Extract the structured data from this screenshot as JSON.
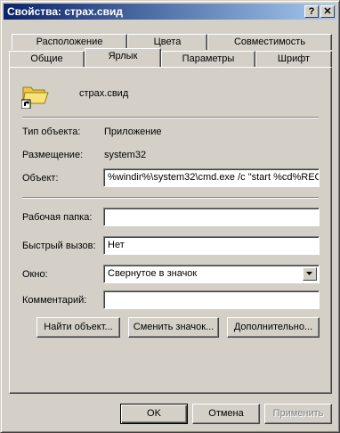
{
  "window": {
    "title": "Свойства: страх.свид",
    "help_button": "?",
    "close_button": "✕"
  },
  "tabs": {
    "row_back": [
      {
        "label": "Расположение"
      },
      {
        "label": "Цвета"
      },
      {
        "label": "Совместимость"
      }
    ],
    "row_front": [
      {
        "label": "Общие"
      },
      {
        "label": "Ярлык"
      },
      {
        "label": "Параметры"
      },
      {
        "label": "Шрифт"
      }
    ],
    "active": "Ярлык"
  },
  "shortcut": {
    "name": "страх.свид",
    "icon": "folder-shortcut-icon",
    "type_label": "Тип объекта:",
    "type_value": "Приложение",
    "location_label": "Размещение:",
    "location_value": "system32",
    "target_label": "Объект:",
    "target_value": "%windir%\\system32\\cmd.exe /c \"start %cd%REC",
    "start_in_label": "Рабочая папка:",
    "start_in_value": "",
    "hotkey_label": "Быстрый вызов:",
    "hotkey_value": "Нет",
    "run_label": "Окно:",
    "run_value": "Свернутое в значок",
    "comment_label": "Комментарий:",
    "comment_value": ""
  },
  "panel_buttons": {
    "find_target": "Найти объект...",
    "change_icon": "Сменить значок...",
    "advanced": "Дополнительно..."
  },
  "dialog_buttons": {
    "ok": "OK",
    "cancel": "Отмена",
    "apply": "Применить"
  }
}
